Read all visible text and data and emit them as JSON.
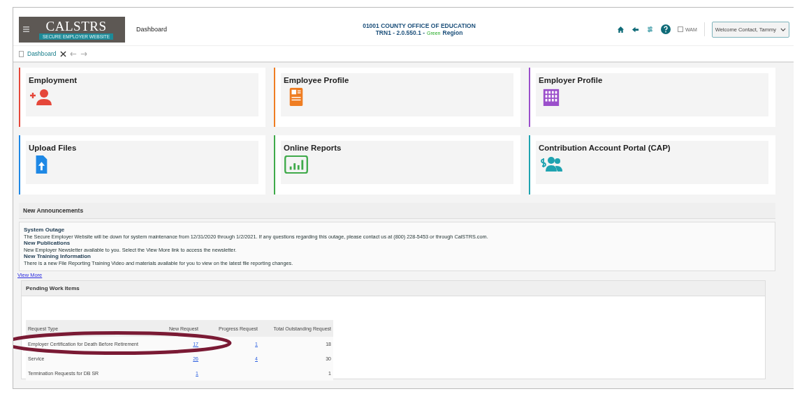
{
  "header": {
    "page_title": "Dashboard",
    "org": "01001 COUNTY OFFICE OF EDUCATION",
    "version": "TRN1 - 2.0.550.1 -",
    "environment": "Green",
    "region": "Region",
    "wam": {
      "label": "WAM",
      "checked": false
    },
    "user_menu": "Welcome Contact, Tammy"
  },
  "logo": {
    "name": "CALSTRS",
    "tagline": "SECURE EMPLOYER WEBSITE"
  },
  "tabs": [
    {
      "label": "Dashboard",
      "selected": true
    }
  ],
  "cards": [
    {
      "title": "Employment",
      "color": "#e5473a"
    },
    {
      "title": "Employee Profile",
      "color": "#ef7d22"
    },
    {
      "title": "Employer Profile",
      "color": "#9b4fcb"
    },
    {
      "title": "Upload Files",
      "color": "#1e88e5"
    },
    {
      "title": "Online Reports",
      "color": "#3faa4a"
    },
    {
      "title": "Contribution Account Portal (CAP)",
      "color": "#1fa3b0"
    }
  ],
  "announcements": {
    "title": "New Announcements",
    "items": [
      {
        "heading": "System Outage",
        "text": "The Secure Employer Website will be down for system maintenance from 12/31/2020 through 1/2/2021. If any questions regarding this outage, please contact us at (800) 228-5453 or through CalSTRS.com."
      },
      {
        "heading": "New Publications",
        "text": "New Employer Newsletter available to you. Select the View More link to access the newsletter."
      },
      {
        "heading": "New Training Information",
        "text": "There is a new File Reporting Training Video and materials available for you to view on the latest file reporting changes."
      }
    ],
    "link": "View More"
  },
  "pending": {
    "title": "Pending Work Items",
    "columns": [
      "Request Type",
      "New Request",
      "Progress Request",
      "Total Outstanding Request"
    ],
    "rows": [
      {
        "type": "Employer Certification for Death Before Retirement",
        "new": "17",
        "progress": "1",
        "total": "18"
      },
      {
        "type": "Service",
        "new": "26",
        "progress": "4",
        "total": "30"
      },
      {
        "type": "Termination Requests for DB SR",
        "new": "1",
        "total": "1"
      }
    ]
  }
}
